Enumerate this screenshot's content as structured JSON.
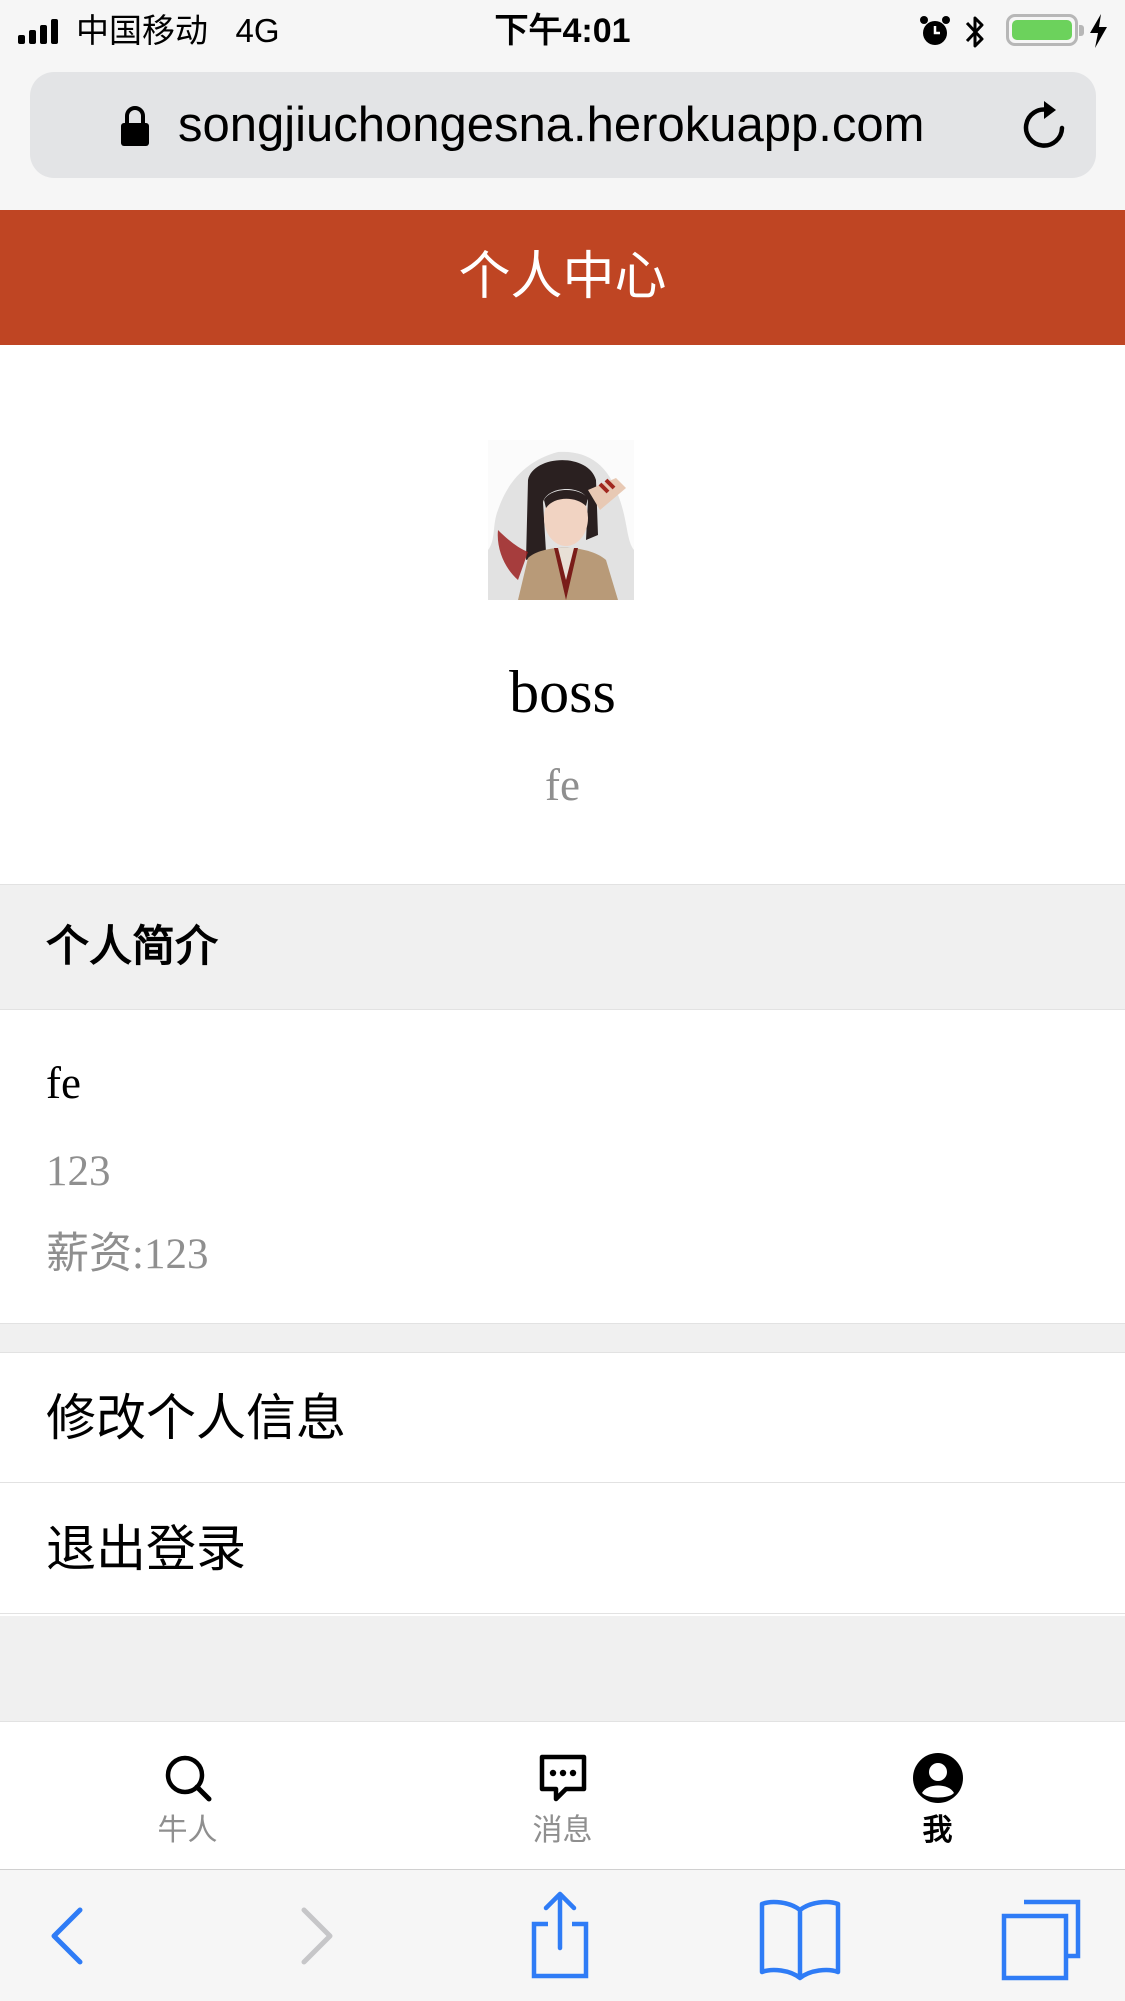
{
  "status_bar": {
    "carrier": "中国移动",
    "network": "4G",
    "time": "下午4:01",
    "battery_color": "#6cd25c"
  },
  "browser": {
    "url": "songjiuchongesna.herokuapp.com",
    "icons": [
      "lock-icon",
      "reload-icon"
    ]
  },
  "header": {
    "title": "个人中心",
    "background": "#bf4523"
  },
  "profile": {
    "username": "boss",
    "title": "fe"
  },
  "intro": {
    "section_label": "个人简介",
    "job_title": "fe",
    "description": "123",
    "salary": "薪资:123"
  },
  "menu": {
    "edit_profile": "修改个人信息",
    "logout": "退出登录"
  },
  "tabbar": {
    "tabs": [
      {
        "label": "牛人",
        "icon": "search-icon",
        "active": false
      },
      {
        "label": "消息",
        "icon": "message-icon",
        "active": false
      },
      {
        "label": "我",
        "icon": "user-icon",
        "active": true
      }
    ]
  },
  "toolbar": {
    "icons": [
      "back-icon",
      "forward-icon",
      "share-icon",
      "bookmarks-icon",
      "tabs-icon"
    ],
    "accent": "#2f7cf6"
  }
}
